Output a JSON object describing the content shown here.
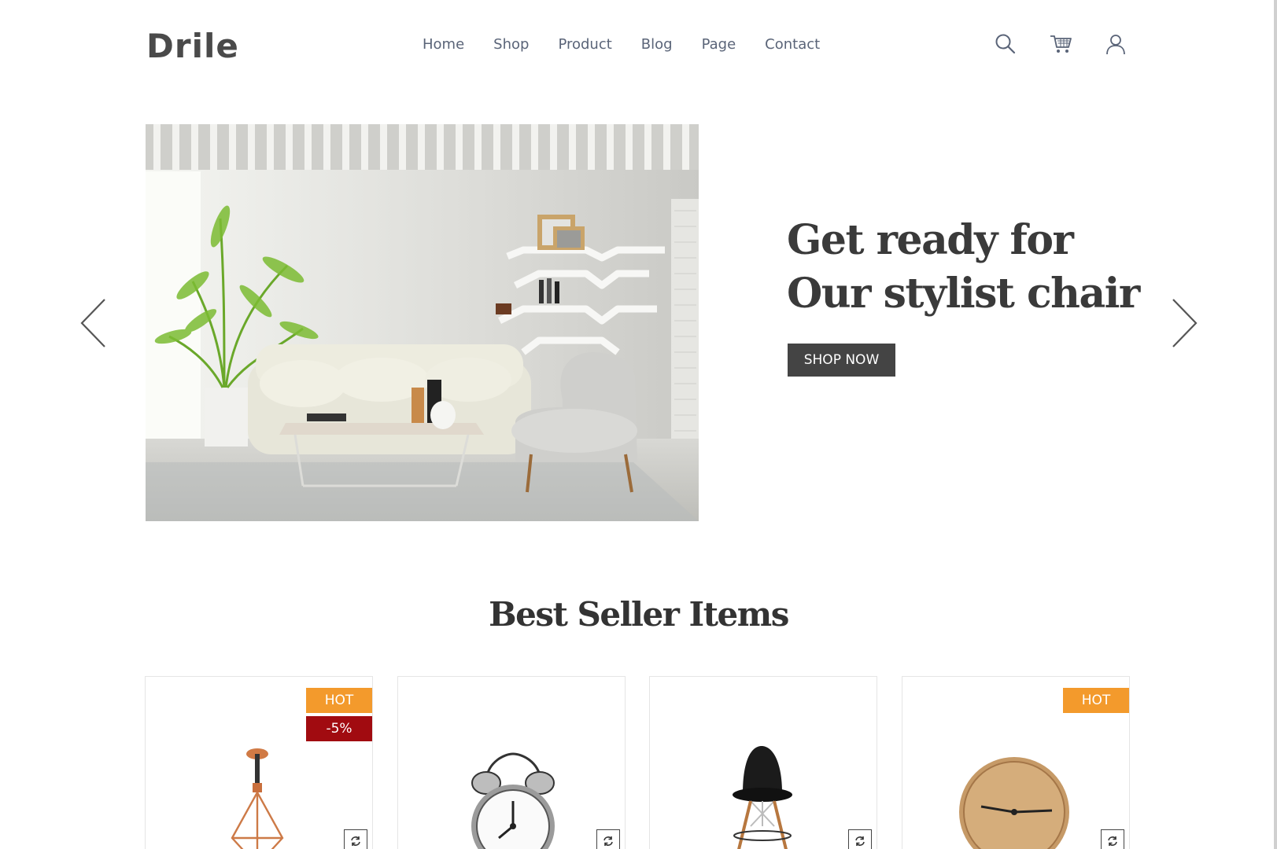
{
  "brand": {
    "logo": "Drile"
  },
  "nav": {
    "items": [
      "Home",
      "Shop",
      "Product",
      "Blog",
      "Page",
      "Contact"
    ]
  },
  "header_icons": [
    "search-icon",
    "cart-icon",
    "user-icon"
  ],
  "hero": {
    "title": "Get ready for Our stylist chair",
    "button": "SHOP NOW"
  },
  "section": {
    "title": "Best Seller Items"
  },
  "products": [
    {
      "name": "pendant-lamp",
      "badges": [
        "HOT",
        "-5%"
      ]
    },
    {
      "name": "alarm-clock",
      "badges": []
    },
    {
      "name": "black-chair",
      "badges": []
    },
    {
      "name": "wall-clock",
      "badges": [
        "HOT"
      ]
    }
  ],
  "colors": {
    "hot": "#f39a2c",
    "sale": "#a10b10",
    "button": "#444444",
    "nav": "#5a6478"
  }
}
